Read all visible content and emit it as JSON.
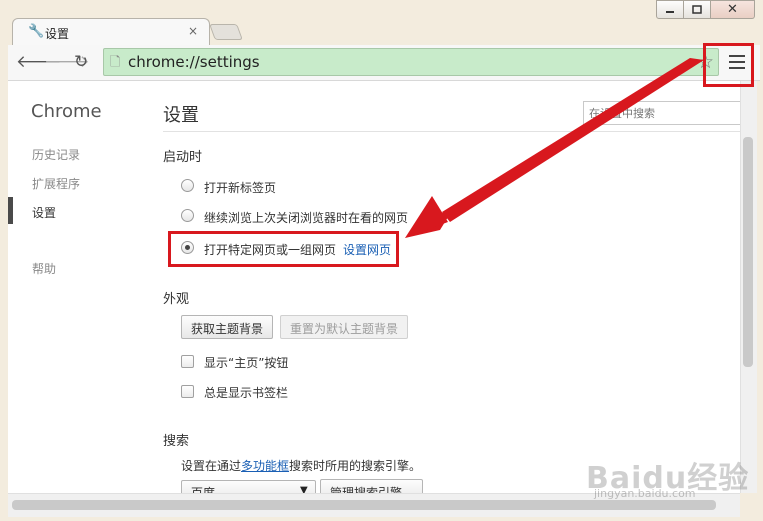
{
  "window": {
    "close_glyph": "✕"
  },
  "tab": {
    "title": "设置",
    "close_glyph": "×"
  },
  "toolbar": {
    "url": "chrome://settings"
  },
  "sidebar": {
    "title": "Chrome",
    "items": [
      {
        "label": "历史记录"
      },
      {
        "label": "扩展程序"
      },
      {
        "label": "设置",
        "active": true
      },
      {
        "label": "帮助"
      }
    ]
  },
  "main": {
    "title": "设置",
    "search_placeholder": "在设置中搜索",
    "startup": {
      "title": "启动时",
      "options": [
        {
          "label": "打开新标签页",
          "checked": false
        },
        {
          "label": "继续浏览上次关闭浏览器时在看的网页",
          "checked": false
        },
        {
          "label": "打开特定网页或一组网页",
          "checked": true
        }
      ],
      "set_pages_link": "设置网页"
    },
    "appearance": {
      "title": "外观",
      "get_themes_label": "获取主题背景",
      "reset_theme_label": "重置为默认主题背景",
      "show_home_label": "显示“主页”按钮",
      "show_bookmarks_label": "总是显示书签栏"
    },
    "search": {
      "title": "搜索",
      "desc_prefix": "设置在通过",
      "desc_link": "多功能框",
      "desc_suffix": "搜索时所用的搜索引擎。",
      "engine_selected": "百度",
      "manage_label": "管理搜索引擎..."
    }
  },
  "annotation": {
    "color": "#d8181e"
  },
  "watermark": {
    "logo": "Baidu经验",
    "url": "jingyan.baidu.com"
  }
}
